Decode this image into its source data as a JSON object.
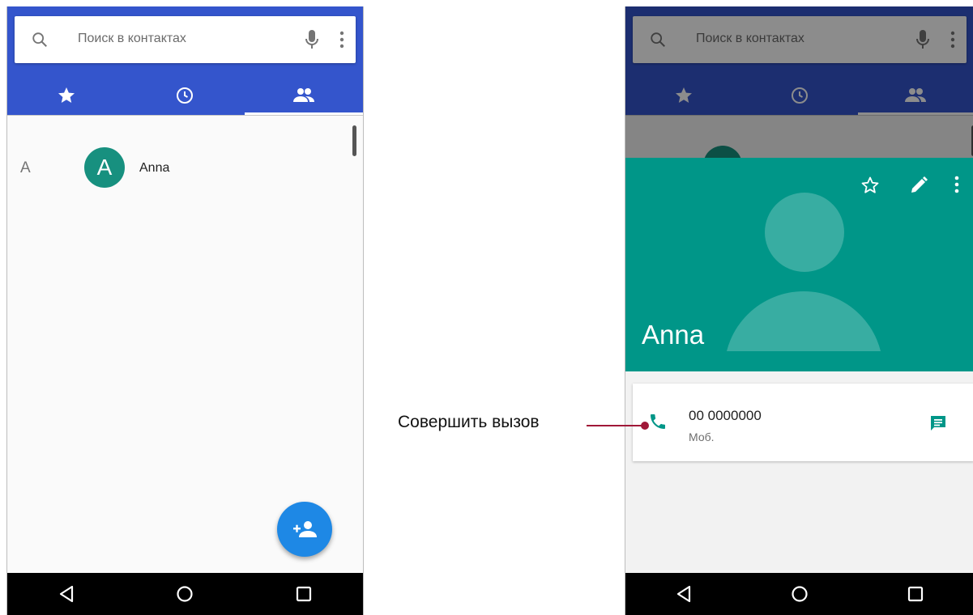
{
  "left_screen": {
    "search": {
      "placeholder": "Поиск в контактах"
    },
    "tabs": [
      {
        "icon": "star-icon",
        "active": false
      },
      {
        "icon": "clock-icon",
        "active": false
      },
      {
        "icon": "people-icon",
        "active": true
      }
    ],
    "contacts": [
      {
        "section_letter": "A",
        "avatar_letter": "A",
        "name": "Anna"
      }
    ],
    "fab": {
      "icon": "add-contact-icon"
    }
  },
  "right_screen": {
    "search": {
      "placeholder": "Поиск в контактах"
    },
    "contact": {
      "name": "Anna",
      "phone_number": "00 0000000",
      "phone_type": "Моб."
    }
  },
  "annotation": {
    "label": "Совершить вызов"
  },
  "colors": {
    "appbar": "#3455cc",
    "header_teal": "#009688",
    "fab_blue": "#1e88e5",
    "callout": "#a01838"
  }
}
